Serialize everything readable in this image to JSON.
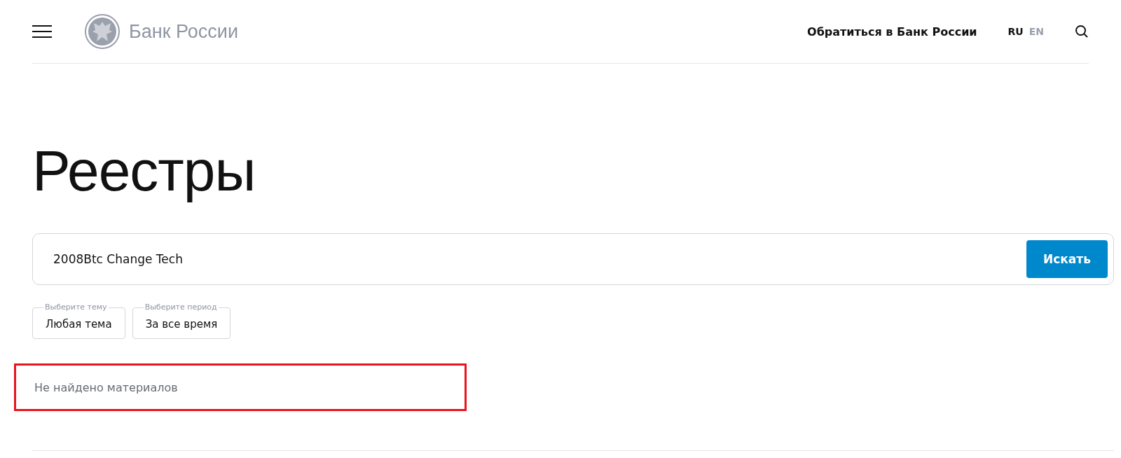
{
  "header": {
    "brand": "Банк России",
    "contact_link": "Обратиться в Банк России",
    "languages": [
      {
        "label": "RU",
        "selected": true
      },
      {
        "label": "EN",
        "selected": false
      }
    ]
  },
  "page_title": "Реестры",
  "search": {
    "value": "2008Btc Change Tech",
    "button": "Искать"
  },
  "filters": [
    {
      "legend": "Выберите тему",
      "value": "Любая тема"
    },
    {
      "legend": "Выберите период",
      "value": "За все время"
    }
  ],
  "result_message": {
    "text": "Не найдено материалов",
    "highlighted": true
  }
}
